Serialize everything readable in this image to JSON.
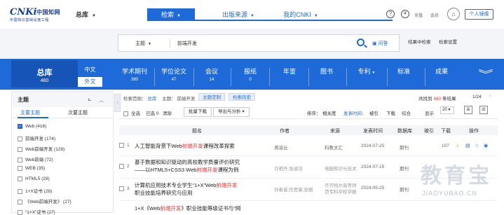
{
  "header": {
    "logo": {
      "brand": "CNKi",
      "brand_cn": "中国知网",
      "subtitle": "中国知识基础设施工程"
    },
    "library_selector": "总库",
    "nav_tabs": [
      {
        "label": "检索",
        "has_dropdown": true,
        "active": true
      },
      {
        "label": "出版来源",
        "has_dropdown": true,
        "active": false
      },
      {
        "label": "我的CNKI",
        "has_dropdown": true,
        "active": false
      }
    ],
    "help_icon": "?",
    "recharge": "充值",
    "member": "会员",
    "personal_library": "个人镜像"
  },
  "search": {
    "field": "主题",
    "query": "前端开发",
    "ai_ask": "问答",
    "search_within": "结果中检索",
    "advanced": "检索设置"
  },
  "db_bar": {
    "all": {
      "label": "总库",
      "count": "480"
    },
    "languages": [
      {
        "label": "中文",
        "active": false
      },
      {
        "label": "外文",
        "active": true
      }
    ],
    "items": [
      {
        "label": "学术期刊",
        "count": "380"
      },
      {
        "label": "学位论文",
        "count": "47"
      },
      {
        "label": "会议",
        "count": "14"
      },
      {
        "label": "报纸",
        "count": "0"
      },
      {
        "label": "年鉴",
        "count": ""
      },
      {
        "label": "图书",
        "count": ""
      },
      {
        "label": "专利",
        "count": ""
      },
      {
        "label": "标准",
        "count": ""
      },
      {
        "label": "成果",
        "count": ""
      }
    ]
  },
  "sidebar": {
    "title": "主题",
    "subtabs": [
      "主要主题",
      "次要主题"
    ],
    "facets": [
      {
        "label": "Web (416)",
        "checked": true
      },
      {
        "label": "前端开发 (174)",
        "checked": false
      },
      {
        "label": "Web前端开发 (129)",
        "checked": false
      },
      {
        "label": "Web前端 (72)",
        "checked": false
      },
      {
        "label": "WEB (35)",
        "checked": false
      },
      {
        "label": "HTML5 (29)",
        "checked": false
      },
      {
        "label": "1+X证书 (28)",
        "checked": false
      },
      {
        "label": "《Web前端开发》 (27)",
        "checked": false
      },
      {
        "label": "\"1+X\"证书 (27)",
        "checked": false
      }
    ]
  },
  "results_header": {
    "scope_label": "检索范围：",
    "scope": "总库",
    "topic_label": "主题：",
    "topic": "前端开发",
    "tag1": "主题定制",
    "tag2": "检索历史",
    "found_prefix": "共找到",
    "found_count": "480",
    "found_suffix": "条结果",
    "page": "1/24"
  },
  "toolbar": {
    "select_all": "全选",
    "selected": "已选",
    "selected_count": "0",
    "clear": "清除",
    "batch_download": "批量下载",
    "export": "导出与分析",
    "sort_label": "排序：",
    "sort_options": [
      {
        "label": "相关度",
        "active": false
      },
      {
        "label": "发表时间",
        "active": true
      },
      {
        "label": "被引",
        "active": false
      },
      {
        "label": "下载",
        "active": false
      },
      {
        "label": "综合",
        "active": false
      }
    ],
    "show_label": "显示",
    "show_value": "20"
  },
  "table": {
    "columns": [
      "题名",
      "作者",
      "来源",
      "发表时间",
      "数据库",
      "被引",
      "下载",
      "操作"
    ],
    "rows": [
      {
        "num": "1",
        "title_pre": "人工智能背景下Web",
        "title_hl": "前端开发",
        "title_post": "课程改革探索",
        "title_line2_pre": "",
        "title_line2_hl": "",
        "title_line2_post": "",
        "author": "周凌云",
        "source": "科教文汇",
        "date": "2024-07-25",
        "db": "期刊",
        "cited": "",
        "downloads": "107"
      },
      {
        "num": "2",
        "title_pre": "基于数据和知识驱动的高校教学质量评价研究",
        "title_hl": "",
        "title_post": "",
        "title_line2_pre": "——以HTML5+CSS3 Web",
        "title_line2_hl": "前端开发",
        "title_line2_post": "课程为例",
        "author": "许艳丹;张淑洁",
        "source": "电脑知识与技术",
        "date": "2024-07-15",
        "db": "期刊",
        "cited": "",
        "downloads": ""
      },
      {
        "num": "3",
        "title_pre": "计算机应用技术专业学生“1+X”Web",
        "title_hl": "前端开发",
        "title_post": "",
        "title_line2_pre": "职业技能培养研究与应用",
        "title_line2_hl": "",
        "title_line2_post": "",
        "author": "孙春苗;任思睿;张丽",
        "source": "齐齐哈尔高等师范专科学校学报",
        "date": "2024-05-25",
        "db": "期刊",
        "cited": "",
        "downloads": ""
      },
      {
        "num": "",
        "title_pre": "1+X《Web",
        "title_hl": "前端开发",
        "title_post": "》职业技能等级证书与“网",
        "title_line2_pre": "",
        "title_line2_hl": "",
        "title_line2_post": "",
        "author": "",
        "source": "",
        "date": "",
        "db": "",
        "cited": "",
        "downloads": ""
      }
    ]
  },
  "watermark": {
    "big": "教育宝",
    "small": "JIAOYUBAO.CN"
  }
}
